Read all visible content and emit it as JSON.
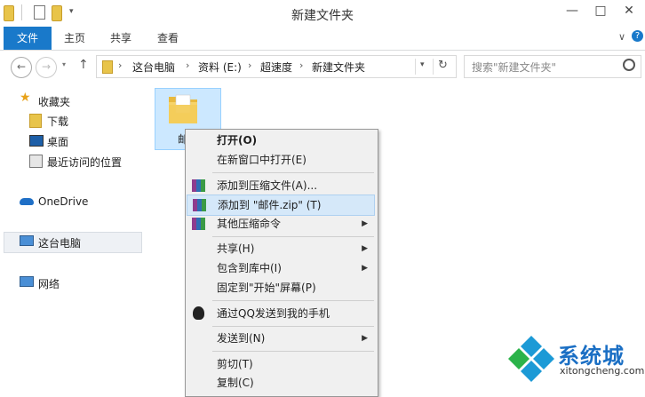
{
  "window": {
    "title": "新建文件夹",
    "minimize": "—",
    "maximize": "□",
    "close": "✕"
  },
  "ribbon": {
    "tabs": [
      "文件",
      "主页",
      "共享",
      "查看"
    ],
    "expand": "∨",
    "help": "?"
  },
  "address": {
    "crumbs": [
      "这台电脑",
      "资料 (E:)",
      "超速度",
      "新建文件夹"
    ],
    "search_placeholder": "搜索\"新建文件夹\""
  },
  "nav": {
    "favorites": "收藏夹",
    "fav_items": [
      "下载",
      "桌面",
      "最近访问的位置"
    ],
    "onedrive": "OneDrive",
    "pc": "这台电脑",
    "network": "网络"
  },
  "content": {
    "folder_label": "邮"
  },
  "menu": {
    "items": [
      {
        "label": "打开(O)",
        "bold": true
      },
      {
        "label": "在新窗口中打开(E)"
      },
      {
        "label": "添加到压缩文件(A)..."
      },
      {
        "label": "添加到 \"邮件.zip\" (T)"
      },
      {
        "label": "其他压缩命令",
        "submenu": true
      },
      {
        "label": "共享(H)",
        "submenu": true
      },
      {
        "label": "包含到库中(I)",
        "submenu": true
      },
      {
        "label": "固定到\"开始\"屏幕(P)"
      },
      {
        "label": "通过QQ发送到我的手机"
      },
      {
        "label": "发送到(N)",
        "submenu": true
      },
      {
        "label": "剪切(T)"
      },
      {
        "label": "复制(C)"
      }
    ],
    "arrow": "▶"
  },
  "watermark": {
    "brand": "系统城",
    "site": "xitongcheng.com"
  },
  "colors": {
    "accent": "#1979ca",
    "selection": "#cce8ff",
    "menu_bg": "#f0f0f0",
    "highlight": "#d5e8f9"
  }
}
